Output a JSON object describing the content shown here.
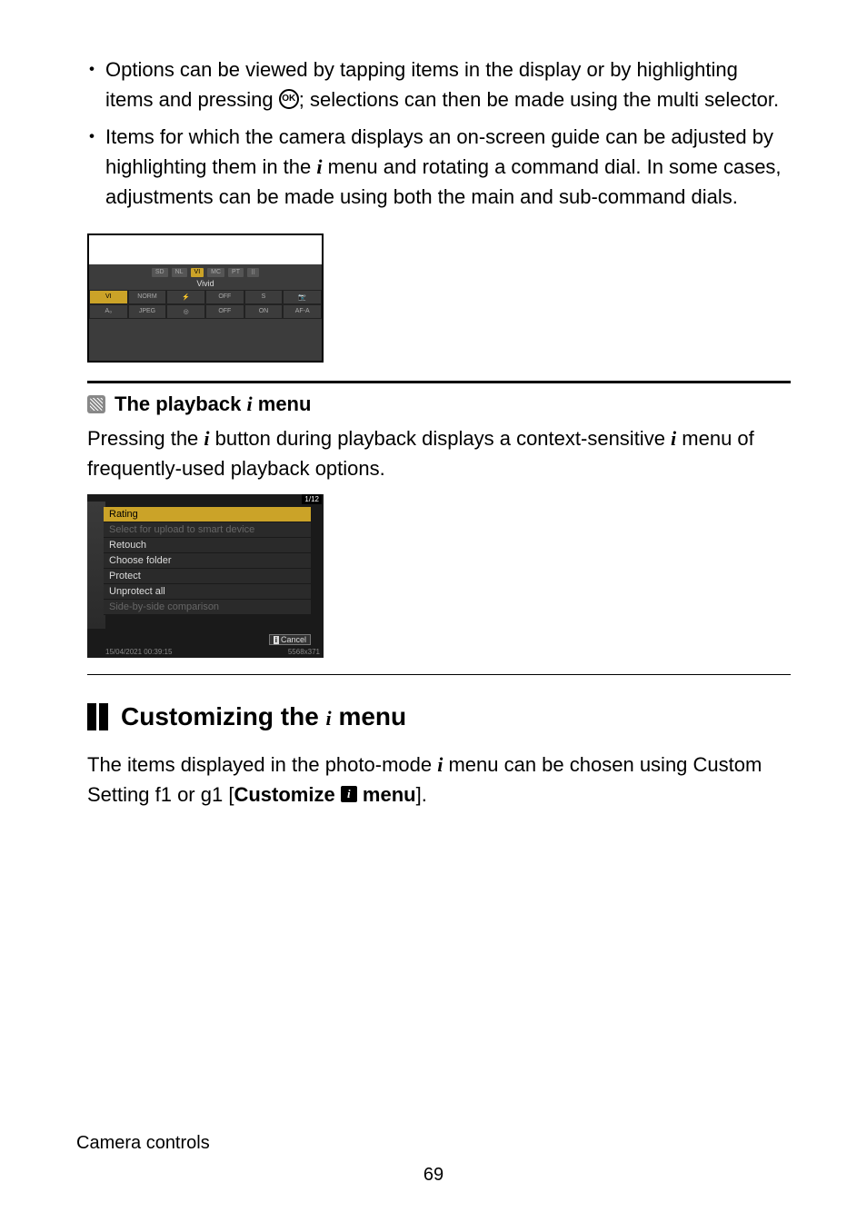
{
  "bullets": [
    {
      "parts": [
        {
          "text": "Options can be viewed by tapping items in the display or by highlighting items and pressing "
        },
        {
          "ok_icon": true
        },
        {
          "text": "; selections can then be made using the multi selector."
        }
      ]
    },
    {
      "parts": [
        {
          "text": "Items for which the camera displays an on-screen guide can be adjusted by highlighting them in the "
        },
        {
          "i_icon": true
        },
        {
          "text": " menu and rotating a command dial. In some cases, adjustments can be made using both the main and sub-command dials."
        }
      ]
    }
  ],
  "camera_display": {
    "tabs": [
      "SD",
      "NL",
      "VI",
      "MC",
      "PT",
      "⠿"
    ],
    "active_tab_index": 2,
    "label": "Vivid",
    "rows": [
      [
        "VI",
        "NORM",
        "⚡",
        "OFF",
        "S",
        "📷"
      ],
      [
        "A₀",
        "JPEG",
        "◎",
        "OFF",
        "ON",
        "AF-A"
      ]
    ],
    "highlighted_cell": [
      0,
      0
    ]
  },
  "subsection": {
    "title_prefix": "The playback ",
    "title_suffix": " menu",
    "body_parts": [
      {
        "text": "Pressing the "
      },
      {
        "i_icon": true
      },
      {
        "text": " button during playback displays a context-sensitive "
      },
      {
        "i_icon": true
      },
      {
        "text": " menu of frequently-used playback options."
      }
    ]
  },
  "playback_menu": {
    "counter": "1/12",
    "items": [
      {
        "label": "Rating",
        "highlighted": true
      },
      {
        "label": "Select for upload to smart device",
        "disabled": true
      },
      {
        "label": "Retouch"
      },
      {
        "label": "Choose folder"
      },
      {
        "label": "Protect"
      },
      {
        "label": "Unprotect all"
      },
      {
        "label": "Side-by-side comparison",
        "disabled": true
      }
    ],
    "cancel_label": "Cancel",
    "footer_left": "15/04/2021 00:39:15",
    "footer_right": "5568x371"
  },
  "section": {
    "title_prefix": "Customizing the ",
    "title_suffix": " menu",
    "body_parts": [
      {
        "text": "The items displayed in the photo-mode "
      },
      {
        "i_icon": true
      },
      {
        "text": " menu can be chosen using Custom Setting f1 or g1 ["
      },
      {
        "strong": "Customize "
      },
      {
        "menu_box": true
      },
      {
        "strong": " menu"
      },
      {
        "text": "]."
      }
    ]
  },
  "footer": {
    "label": "Camera controls",
    "page": "69"
  }
}
